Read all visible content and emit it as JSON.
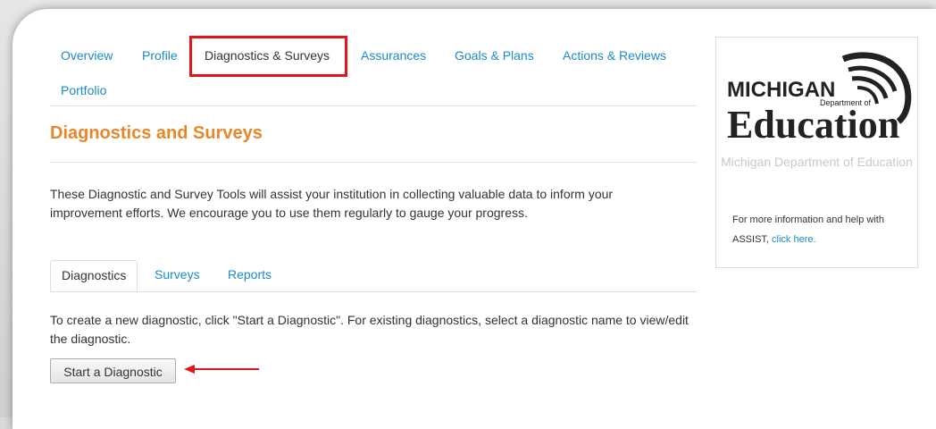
{
  "nav": {
    "items": [
      {
        "label": "Overview"
      },
      {
        "label": "Profile"
      },
      {
        "label": "Diagnostics & Surveys"
      },
      {
        "label": "Assurances"
      },
      {
        "label": "Goals & Plans"
      },
      {
        "label": "Actions & Reviews"
      },
      {
        "label": "Portfolio"
      }
    ],
    "active_index": 2
  },
  "page": {
    "title": "Diagnostics and Surveys",
    "description": "These Diagnostic and Survey Tools will assist your institution in collecting valuable data to inform your improvement efforts. We encourage you to use them regularly to gauge your progress."
  },
  "tabs": {
    "items": [
      {
        "label": "Diagnostics"
      },
      {
        "label": "Surveys"
      },
      {
        "label": "Reports"
      }
    ],
    "active_index": 0
  },
  "diagnostics": {
    "instructions": "To create a new diagnostic, click \"Start a Diagnostic\". For existing diagnostics, select a diagnostic name to view/edit the diagnostic.",
    "start_button_label": "Start a Diagnostic"
  },
  "sidebar": {
    "logo": {
      "line1": "MICHIGAN",
      "line2": "Department of",
      "line3": "Education"
    },
    "org_name": "Michigan Department of Education",
    "info_text": "For more information and help with ASSIST,",
    "info_link": "click here."
  },
  "colors": {
    "link": "#1a8ac8",
    "title": "#e8862a",
    "highlight": "#e3161b"
  }
}
